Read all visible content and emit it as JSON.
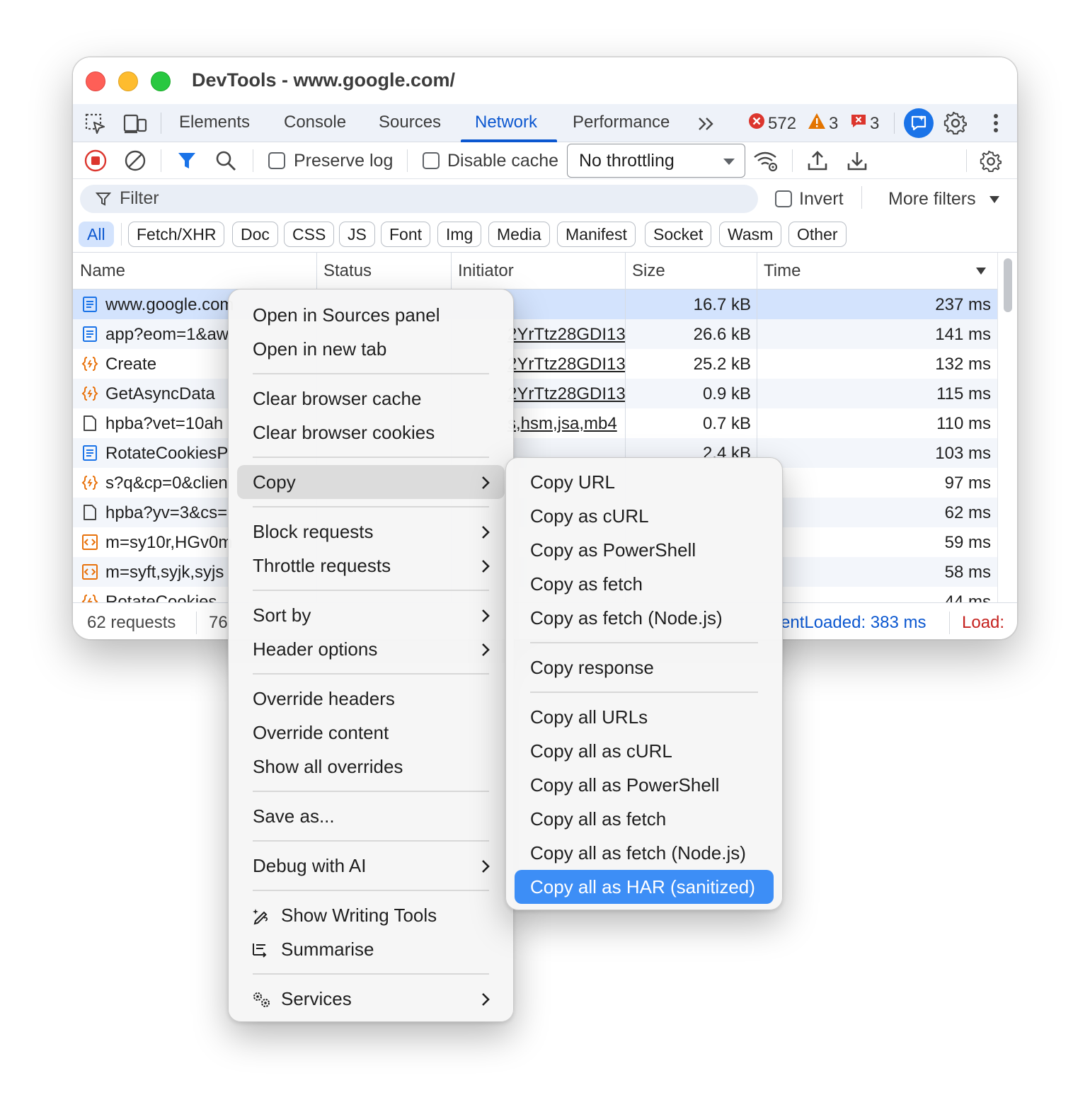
{
  "window": {
    "title": "DevTools - www.google.com/"
  },
  "tabs": [
    {
      "label": "Elements"
    },
    {
      "label": "Console"
    },
    {
      "label": "Sources"
    },
    {
      "label": "Network",
      "active": true
    },
    {
      "label": "Performance"
    }
  ],
  "counters": {
    "errors": "572",
    "warnings": "3",
    "issues": "3"
  },
  "toolbar": {
    "preserve_log": "Preserve log",
    "disable_cache": "Disable cache",
    "throttling": "No throttling"
  },
  "filter": {
    "placeholder": "Filter",
    "invert": "Invert",
    "more_filters": "More filters"
  },
  "type_filters": [
    "All",
    "Fetch/XHR",
    "Doc",
    "CSS",
    "JS",
    "Font",
    "Img",
    "Media",
    "Manifest",
    "Socket",
    "Wasm",
    "Other"
  ],
  "columns": {
    "name": "Name",
    "status": "Status",
    "initiator": "Initiator",
    "size": "Size",
    "time": "Time"
  },
  "requests": [
    {
      "name": "www.google.com",
      "initiator": "",
      "size": "16.7 kB",
      "time": "237 ms",
      "icon": "document-icon",
      "selected": true
    },
    {
      "name": "app?eom=1&aw",
      "initiator": "2YrTtz28GDI13",
      "size": "26.6 kB",
      "time": "141 ms",
      "icon": "document-icon"
    },
    {
      "name": "Create",
      "initiator": "2YrTtz28GDI13",
      "size": "25.2 kB",
      "time": "132 ms",
      "icon": "fetch-icon"
    },
    {
      "name": "GetAsyncData",
      "initiator": "2YrTtz28GDI13",
      "size": "0.9 kB",
      "time": "115 ms",
      "icon": "fetch-icon"
    },
    {
      "name": "hpba?vet=10ah",
      "initiator": "s,hsm,jsa,mb4",
      "size": "0.7 kB",
      "time": "110 ms",
      "icon": "file-icon"
    },
    {
      "name": "RotateCookiesP",
      "initiator": "",
      "size": "2.4 kB",
      "time": "103 ms",
      "icon": "document-icon"
    },
    {
      "name": "s?q&cp=0&clien",
      "initiator": "",
      "size": "",
      "time": "97 ms",
      "icon": "fetch-icon"
    },
    {
      "name": "hpba?yv=3&cs=",
      "initiator": "",
      "size": "",
      "time": "62 ms",
      "icon": "file-icon"
    },
    {
      "name": "m=sy10r,HGv0m",
      "initiator": "",
      "size": "",
      "time": "59 ms",
      "icon": "script-icon"
    },
    {
      "name": "m=syft,syjk,syjs",
      "initiator": "",
      "size": "",
      "time": "58 ms",
      "icon": "script-icon"
    },
    {
      "name": "RotateCookies",
      "initiator": "",
      "size": "",
      "time": "44 ms",
      "icon": "fetch-icon"
    }
  ],
  "statusbar": {
    "requests": "62 requests",
    "transferred": "76",
    "dom_loaded": "entLoaded: 383 ms",
    "load": "Load:"
  },
  "context_menu": {
    "groups": [
      [
        {
          "label": "Open in Sources panel"
        },
        {
          "label": "Open in new tab"
        }
      ],
      [
        {
          "label": "Clear browser cache"
        },
        {
          "label": "Clear browser cookies"
        }
      ],
      [
        {
          "label": "Copy",
          "submenu": true,
          "hover": true
        }
      ],
      [
        {
          "label": "Block requests",
          "submenu": true
        },
        {
          "label": "Throttle requests",
          "submenu": true
        }
      ],
      [
        {
          "label": "Sort by",
          "submenu": true
        },
        {
          "label": "Header options",
          "submenu": true
        }
      ],
      [
        {
          "label": "Override headers"
        },
        {
          "label": "Override content"
        },
        {
          "label": "Show all overrides"
        }
      ],
      [
        {
          "label": "Save as..."
        }
      ],
      [
        {
          "label": "Debug with AI",
          "submenu": true
        }
      ],
      [
        {
          "label": "Show Writing Tools",
          "icon": "writing-tools-icon"
        },
        {
          "label": "Summarise",
          "icon": "summarise-icon"
        }
      ],
      [
        {
          "label": "Services",
          "submenu": true,
          "icon": "services-icon"
        }
      ]
    ]
  },
  "copy_submenu": {
    "groups": [
      [
        {
          "label": "Copy URL"
        },
        {
          "label": "Copy as cURL"
        },
        {
          "label": "Copy as PowerShell"
        },
        {
          "label": "Copy as fetch"
        },
        {
          "label": "Copy as fetch (Node.js)"
        }
      ],
      [
        {
          "label": "Copy response"
        }
      ],
      [
        {
          "label": "Copy all URLs"
        },
        {
          "label": "Copy all as cURL"
        },
        {
          "label": "Copy all as PowerShell"
        },
        {
          "label": "Copy all as fetch"
        },
        {
          "label": "Copy all as fetch (Node.js)"
        },
        {
          "label": "Copy all as HAR (sanitized)",
          "highlighted": true
        }
      ]
    ]
  },
  "colors": {
    "accent": "#0b57d0",
    "selected_row": "#d3e3fd",
    "menu_highlight": "#3d8ef6",
    "error": "#dc362e",
    "warning": "#e37400"
  }
}
